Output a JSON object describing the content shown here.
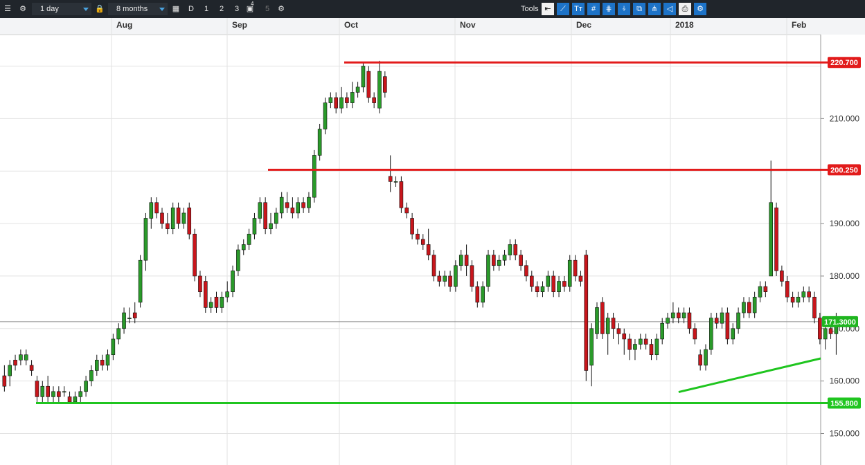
{
  "toolbar": {
    "interval": "1 day",
    "period": "8 months",
    "timeframes": [
      "D",
      "1",
      "2",
      "3",
      "4",
      "5"
    ],
    "tools_label": "Tools"
  },
  "chart_data": {
    "type": "candlestick",
    "x_labels": [
      "Aug",
      "Sep",
      "Oct",
      "Nov",
      "Dec",
      "2018",
      "Feb"
    ],
    "y_ticks": [
      "150.000",
      "160.000",
      "170.000",
      "180.000",
      "190.000",
      "210.000"
    ],
    "ylim": [
      144,
      226
    ],
    "grid": true,
    "current_price": "171.3000",
    "horizontal_lines": [
      {
        "value": 220.7,
        "label": "220.700",
        "color": "#e21b1b"
      },
      {
        "value": 200.25,
        "label": "200.250",
        "color": "#e21b1b"
      },
      {
        "value": 155.8,
        "label": "155.800",
        "color": "#1fc51f"
      }
    ],
    "trendline": {
      "color": "#1fc51f",
      "from": [
        124,
        157.9
      ],
      "to": [
        171,
        164.3
      ]
    },
    "colors": {
      "up": "#2a9a2a",
      "down": "#c8161c"
    },
    "candles": [
      [
        1,
        161,
        159,
        163,
        158
      ],
      [
        2,
        161,
        163,
        164,
        159
      ],
      [
        3,
        164,
        163,
        165,
        162
      ],
      [
        4,
        164,
        165,
        166,
        163
      ],
      [
        5,
        164,
        165,
        166,
        163
      ],
      [
        6,
        163,
        162,
        164,
        161
      ],
      [
        7,
        160,
        157,
        161,
        156
      ],
      [
        8,
        157,
        159,
        160,
        156
      ],
      [
        9,
        159,
        157,
        161,
        156
      ],
      [
        10,
        157,
        158,
        159,
        156
      ],
      [
        11,
        158,
        157,
        159,
        156
      ],
      [
        12,
        158,
        158,
        159,
        157
      ],
      [
        13,
        157,
        156,
        158,
        155.6
      ],
      [
        14,
        156,
        157,
        158,
        155.6
      ],
      [
        15,
        157,
        158,
        159,
        156
      ],
      [
        16,
        158,
        160,
        161,
        157
      ],
      [
        17,
        160,
        162,
        163,
        159
      ],
      [
        18,
        162,
        164,
        165,
        161
      ],
      [
        19,
        164,
        163,
        165,
        162
      ],
      [
        20,
        163,
        165,
        166,
        162
      ],
      [
        21,
        165,
        168,
        169,
        164
      ],
      [
        22,
        168,
        170,
        171,
        167
      ],
      [
        23,
        170,
        173,
        174,
        169
      ],
      [
        24,
        172,
        172,
        174,
        171
      ],
      [
        25,
        173,
        172,
        175,
        171
      ],
      [
        26,
        175,
        183,
        184,
        174
      ],
      [
        27,
        183,
        191,
        192,
        181
      ],
      [
        28,
        191,
        194,
        195,
        189
      ],
      [
        29,
        194,
        192,
        195,
        191
      ],
      [
        30,
        192,
        190,
        193,
        189
      ],
      [
        31,
        190,
        189,
        192,
        188
      ],
      [
        32,
        189,
        193,
        194,
        188
      ],
      [
        33,
        193,
        190,
        194,
        189
      ],
      [
        34,
        190,
        192,
        193,
        189
      ],
      [
        35,
        193,
        188,
        194,
        187
      ],
      [
        36,
        188,
        180,
        189,
        179
      ],
      [
        37,
        180,
        177,
        181,
        176
      ],
      [
        38,
        179,
        174,
        180,
        173
      ],
      [
        39,
        174,
        175,
        176,
        173
      ],
      [
        40,
        176,
        174,
        177,
        173
      ],
      [
        41,
        174,
        176,
        177,
        173
      ],
      [
        42,
        176,
        177,
        179,
        175
      ],
      [
        43,
        177,
        181,
        182,
        176
      ],
      [
        44,
        181,
        185,
        186,
        180
      ],
      [
        45,
        185,
        186,
        187,
        184
      ],
      [
        46,
        186,
        188,
        189,
        185
      ],
      [
        47,
        188,
        191,
        192,
        187
      ],
      [
        48,
        191,
        194,
        195,
        190
      ],
      [
        49,
        194,
        189,
        195,
        188
      ],
      [
        50,
        189,
        190,
        192,
        188
      ],
      [
        51,
        190,
        192,
        193,
        189
      ],
      [
        52,
        192,
        195,
        196,
        191
      ],
      [
        53,
        194,
        193,
        196,
        192
      ],
      [
        54,
        193,
        192,
        195,
        191
      ],
      [
        55,
        192,
        194,
        195,
        191
      ],
      [
        56,
        194,
        193,
        195,
        192
      ],
      [
        57,
        193,
        195,
        196,
        192
      ],
      [
        58,
        195,
        203,
        204,
        194
      ],
      [
        59,
        203,
        208,
        209,
        202
      ],
      [
        60,
        208,
        213,
        214,
        207
      ],
      [
        61,
        213,
        214,
        215,
        212
      ],
      [
        62,
        214,
        212,
        215,
        211
      ],
      [
        63,
        212,
        214,
        216,
        211
      ],
      [
        64,
        214,
        213,
        215,
        212
      ],
      [
        65,
        213,
        215,
        217,
        212
      ],
      [
        66,
        215,
        216,
        217,
        214
      ],
      [
        67,
        216,
        220,
        220.7,
        215
      ],
      [
        68,
        219,
        214,
        220,
        213
      ],
      [
        69,
        214,
        213,
        215,
        212
      ],
      [
        70,
        212,
        219,
        221,
        211
      ],
      [
        71,
        218,
        215,
        219,
        214
      ],
      [
        72,
        199,
        198,
        203,
        196
      ],
      [
        73,
        198,
        198,
        199,
        197
      ],
      [
        74,
        198,
        193,
        199,
        192
      ],
      [
        75,
        193,
        192,
        194,
        191
      ],
      [
        76,
        191,
        188,
        192,
        187
      ],
      [
        77,
        188,
        187,
        189,
        186
      ],
      [
        78,
        187,
        186,
        188,
        185
      ],
      [
        79,
        186,
        184,
        189,
        183
      ],
      [
        80,
        184,
        180,
        185,
        179
      ],
      [
        81,
        180,
        179,
        181,
        178
      ],
      [
        82,
        179,
        180,
        181,
        178
      ],
      [
        83,
        180,
        178,
        181,
        177
      ],
      [
        84,
        178,
        182,
        183,
        177
      ],
      [
        85,
        182,
        184,
        185,
        181
      ],
      [
        86,
        184,
        182,
        186,
        180
      ],
      [
        87,
        182,
        178,
        183,
        177
      ],
      [
        88,
        178,
        175,
        179,
        174
      ],
      [
        89,
        175,
        178,
        179,
        174
      ],
      [
        90,
        178,
        184,
        185,
        177
      ],
      [
        91,
        184,
        182,
        185,
        181
      ],
      [
        92,
        182,
        183,
        184,
        181
      ],
      [
        93,
        183,
        184,
        185,
        182
      ],
      [
        94,
        184,
        186,
        187,
        183
      ],
      [
        95,
        186,
        184,
        187,
        183
      ],
      [
        96,
        184,
        182,
        185,
        181
      ],
      [
        97,
        182,
        180,
        183,
        179
      ],
      [
        98,
        180,
        178,
        181,
        177
      ],
      [
        99,
        178,
        177,
        179,
        176
      ],
      [
        100,
        177,
        178,
        179,
        176
      ],
      [
        101,
        178,
        180,
        181,
        177
      ],
      [
        102,
        180,
        177,
        181,
        176
      ],
      [
        103,
        177,
        179,
        180,
        176
      ],
      [
        104,
        179,
        178,
        180,
        177
      ],
      [
        105,
        178,
        183,
        184,
        177
      ],
      [
        106,
        183,
        180,
        184,
        179
      ],
      [
        107,
        180,
        179,
        181,
        178
      ],
      [
        108,
        184,
        162,
        185,
        160
      ],
      [
        109,
        163,
        170,
        171,
        159
      ],
      [
        110,
        169,
        174,
        175,
        168
      ],
      [
        111,
        175,
        169,
        176,
        168
      ],
      [
        112,
        169,
        172,
        173,
        165
      ],
      [
        113,
        172,
        170,
        173,
        168
      ],
      [
        114,
        170,
        169,
        171,
        167
      ],
      [
        115,
        169,
        168,
        170,
        165
      ],
      [
        116,
        168,
        166,
        169,
        164
      ],
      [
        117,
        166,
        167,
        168,
        164
      ],
      [
        118,
        167,
        168,
        169,
        166
      ],
      [
        119,
        168,
        167,
        169,
        166
      ],
      [
        120,
        167,
        165,
        168,
        164
      ],
      [
        121,
        165,
        168,
        169,
        164
      ],
      [
        122,
        168,
        171,
        172,
        167
      ],
      [
        123,
        171,
        172,
        173,
        170
      ],
      [
        124,
        172,
        173,
        175,
        171
      ],
      [
        125,
        173,
        172,
        174,
        171
      ],
      [
        126,
        172,
        173,
        174,
        171
      ],
      [
        127,
        173,
        170,
        174,
        169
      ],
      [
        128,
        170,
        168,
        171,
        167
      ],
      [
        129,
        165,
        163,
        166,
        162
      ],
      [
        130,
        163,
        166,
        167,
        162
      ],
      [
        131,
        166,
        172,
        173,
        165
      ],
      [
        132,
        172,
        171,
        173,
        170
      ],
      [
        133,
        171,
        173,
        174,
        170
      ],
      [
        134,
        173,
        168,
        174,
        167
      ],
      [
        135,
        168,
        170,
        171,
        167
      ],
      [
        136,
        170,
        173,
        174,
        169
      ],
      [
        137,
        173,
        175,
        176,
        172
      ],
      [
        138,
        175,
        173,
        176,
        172
      ],
      [
        139,
        173,
        176,
        177,
        172
      ],
      [
        140,
        176,
        178,
        179,
        175
      ],
      [
        141,
        178,
        177,
        179,
        176
      ],
      [
        142,
        180,
        194,
        202,
        193
      ],
      [
        143,
        193,
        181,
        194,
        180
      ],
      [
        144,
        181,
        179,
        182,
        178
      ],
      [
        145,
        179,
        176,
        180,
        175
      ],
      [
        146,
        176,
        175,
        177,
        174
      ],
      [
        147,
        175,
        176,
        177,
        174
      ],
      [
        148,
        176,
        177,
        178,
        175
      ],
      [
        149,
        177,
        176,
        178,
        175
      ],
      [
        150,
        176,
        172,
        177,
        171
      ],
      [
        151,
        172,
        168,
        173,
        167
      ],
      [
        152,
        168,
        170,
        171,
        166
      ],
      [
        153,
        170,
        169,
        171,
        168
      ],
      [
        154,
        169,
        172,
        173,
        165
      ]
    ]
  }
}
